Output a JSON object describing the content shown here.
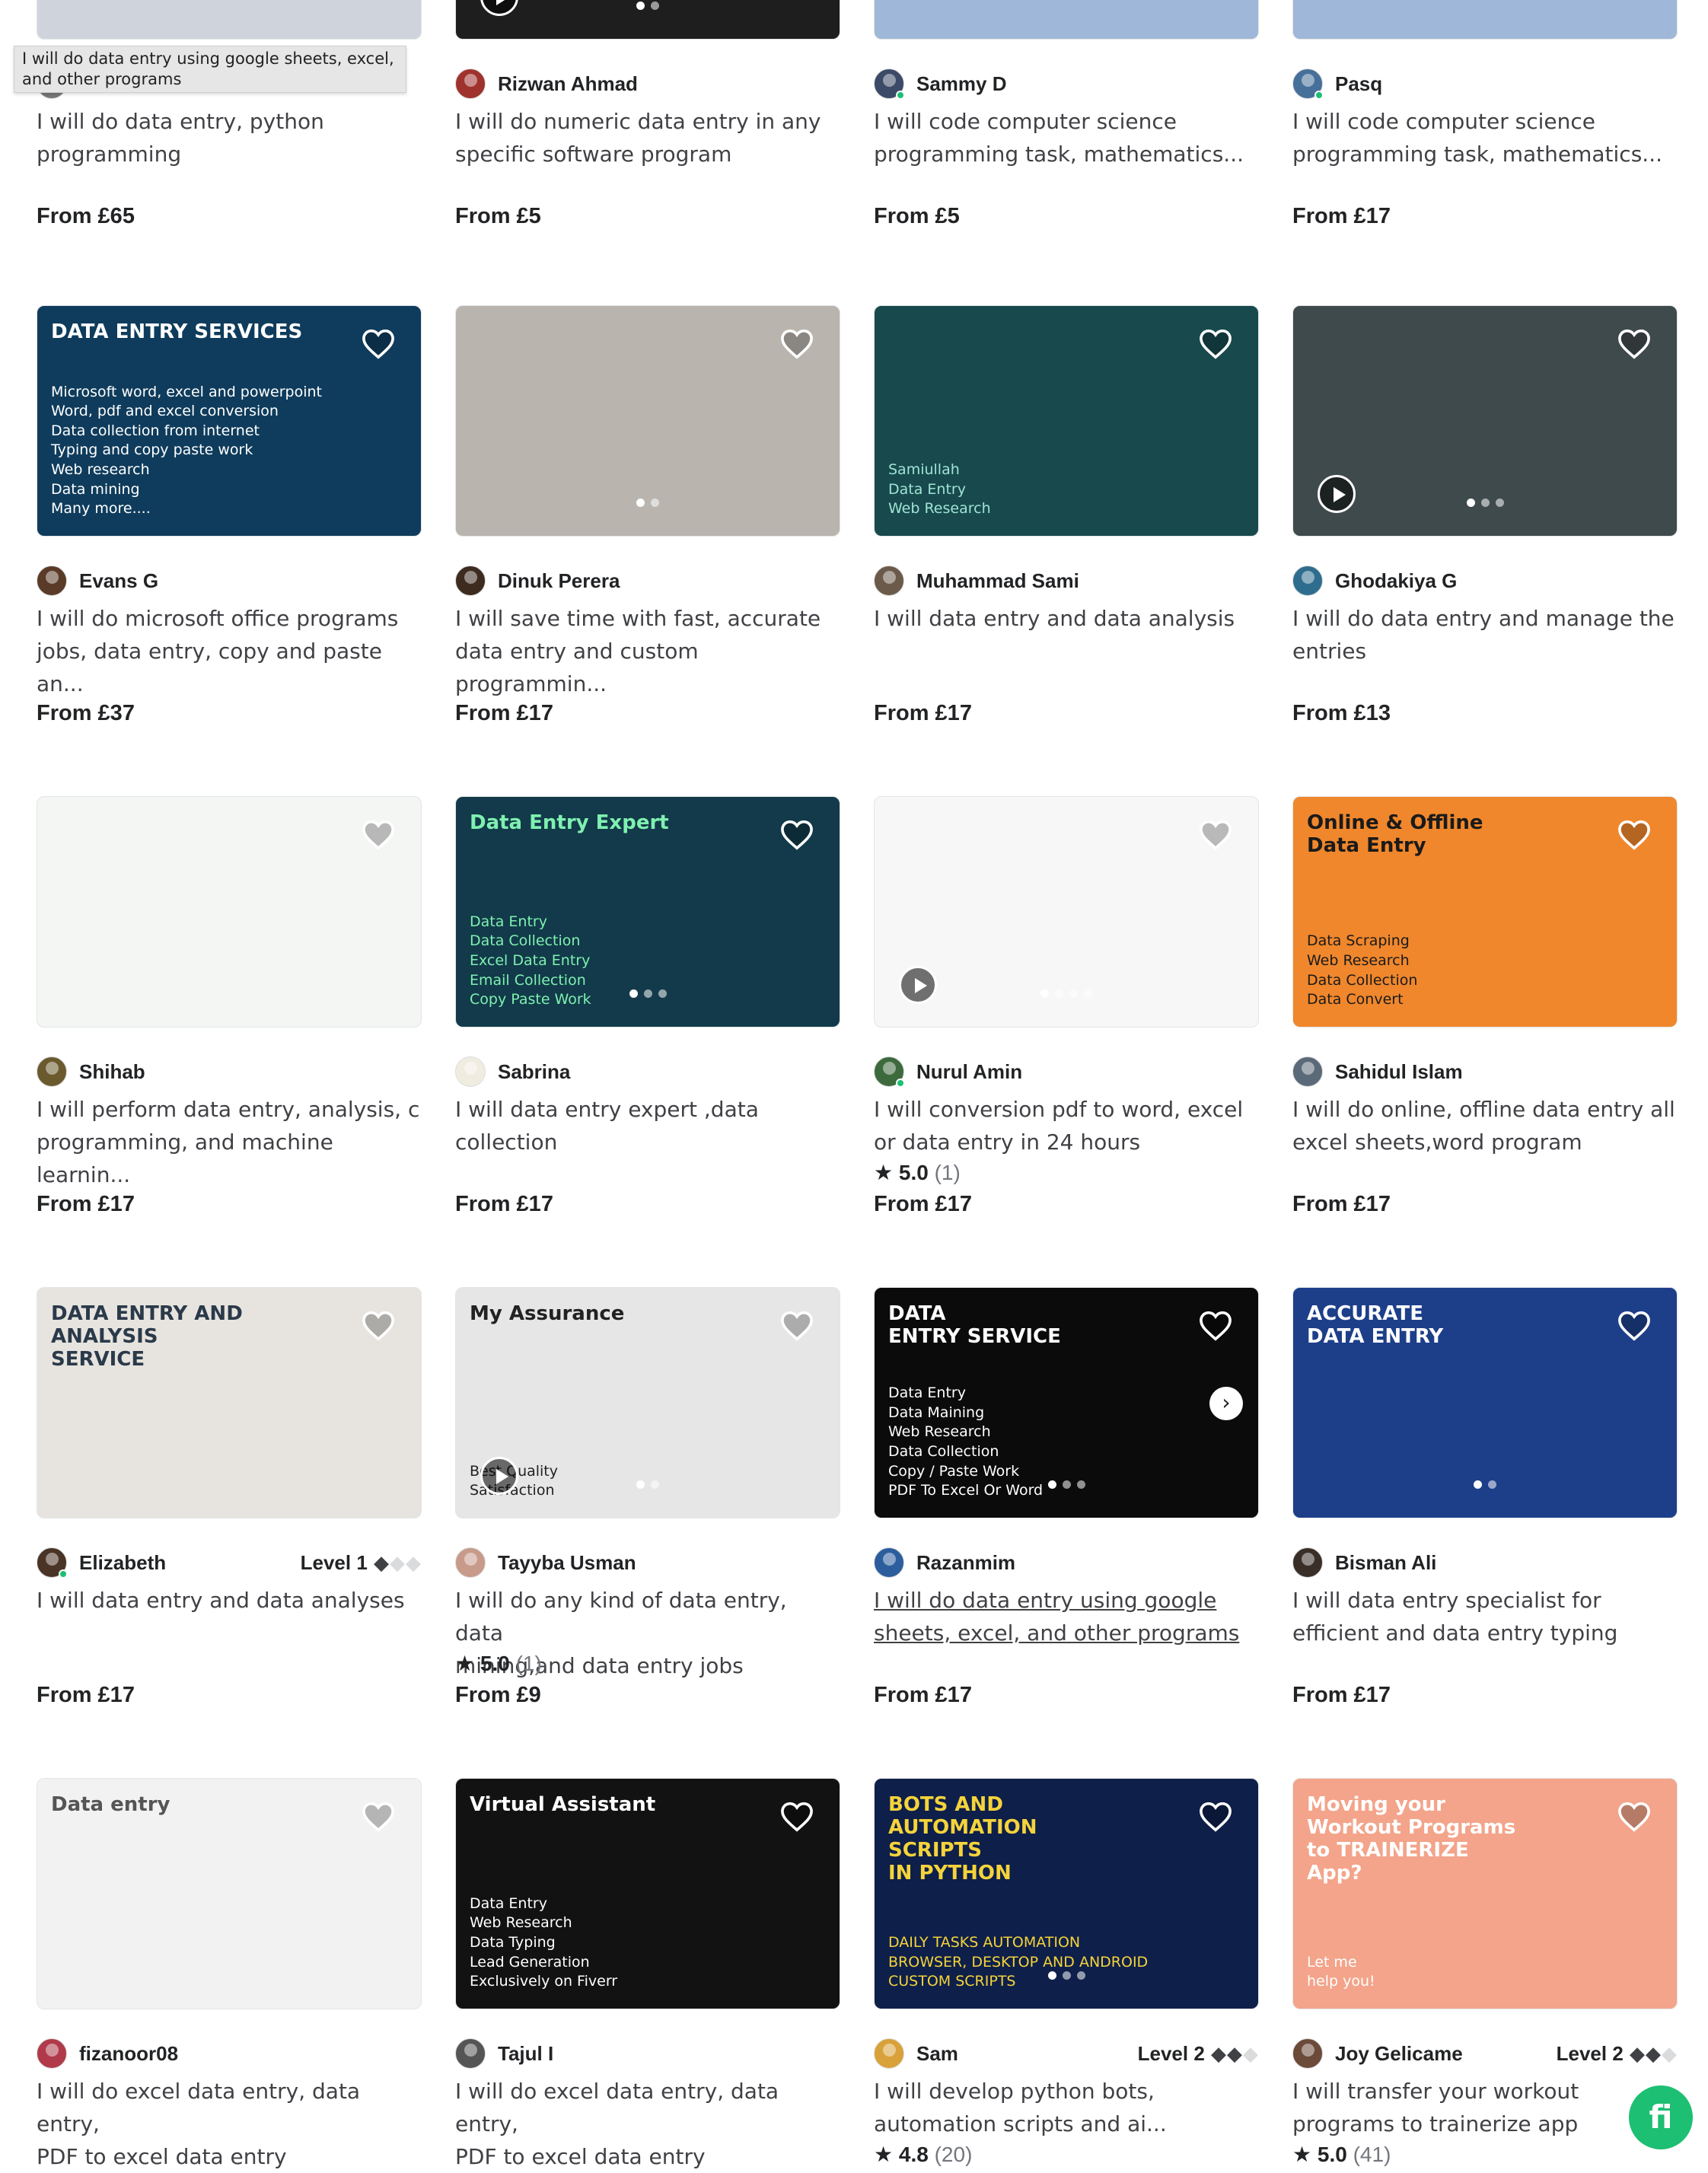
{
  "tooltip": "I will do data entry using google sheets, excel, and other programs",
  "chat_button_label": "fi",
  "cards": [
    {
      "seller": "",
      "level": "",
      "level_on": 0,
      "title": "I will do data entry, python\nprogramming",
      "price": "From £65",
      "rating": "",
      "rating_count": "",
      "thumb_bg": "#cfd4dc",
      "thumb_text": "",
      "thumb_sub": "",
      "thumb_color": "#222",
      "play": false,
      "dots": 0,
      "online": false,
      "avatar_color": "#777",
      "underline": false
    },
    {
      "seller": "Rizwan Ahmad",
      "level": "",
      "level_on": 0,
      "title": "I will do numeric data entry in any\nspecific software program",
      "price": "From £5",
      "rating": "",
      "rating_count": "",
      "thumb_bg": "#1e1e1e",
      "thumb_text": "",
      "thumb_sub": "",
      "thumb_color": "#fff",
      "play": true,
      "dots": 2,
      "online": false,
      "avatar_color": "#a0322e",
      "underline": false
    },
    {
      "seller": "Sammy D",
      "level": "",
      "level_on": 0,
      "title": "I will code computer science\nprogramming task, mathematics...",
      "price": "From £5",
      "rating": "",
      "rating_count": "",
      "thumb_bg": "#9fb7d8",
      "thumb_text": "",
      "thumb_sub": "",
      "thumb_color": "#222",
      "play": false,
      "dots": 0,
      "online": true,
      "avatar_color": "#3b4a66",
      "underline": false
    },
    {
      "seller": "Pasq",
      "level": "",
      "level_on": 0,
      "title": "I will code computer science\nprogramming task, mathematics...",
      "price": "From £17",
      "rating": "",
      "rating_count": "",
      "thumb_bg": "#9fb7d8",
      "thumb_text": "",
      "thumb_sub": "",
      "thumb_color": "#222",
      "play": false,
      "dots": 0,
      "online": true,
      "avatar_color": "#46709a",
      "underline": false
    },
    {
      "seller": "Evans G",
      "level": "",
      "level_on": 0,
      "title": "I will do microsoft office programs\njobs, data entry, copy and paste an...",
      "price": "From £37",
      "rating": "",
      "rating_count": "",
      "thumb_bg": "#0f3c5c",
      "thumb_text": "DATA ENTRY SERVICES",
      "thumb_sub": "Microsoft word, excel and powerpoint\nWord, pdf and excel conversion\nData collection from internet\nTyping and copy paste work\nWeb research\nData mining\nMany more....",
      "thumb_color": "#ffffff",
      "play": false,
      "dots": 0,
      "online": false,
      "avatar_color": "#5a3b28",
      "underline": false
    },
    {
      "seller": "Dinuk Perera",
      "level": "",
      "level_on": 0,
      "title": "I will save time with fast, accurate\ndata entry and custom programmin...",
      "price": "From £17",
      "rating": "",
      "rating_count": "",
      "thumb_bg": "#b9b5ae",
      "thumb_text": "",
      "thumb_sub": "",
      "thumb_color": "#222",
      "play": false,
      "dots": 2,
      "online": false,
      "avatar_color": "#3d2b20",
      "underline": false
    },
    {
      "seller": "Muhammad Sami",
      "level": "",
      "level_on": 0,
      "title": "I will data entry and data analysis",
      "price": "From £17",
      "rating": "",
      "rating_count": "",
      "thumb_bg": "#17494d",
      "thumb_text": "",
      "thumb_sub": "Samiullah\nData Entry\nWeb Research",
      "thumb_color": "#9fe3d4",
      "play": false,
      "dots": 0,
      "online": false,
      "avatar_color": "#6b5a4a",
      "underline": false
    },
    {
      "seller": "Ghodakiya G",
      "level": "",
      "level_on": 0,
      "title": "I will do data entry and manage the\nentries",
      "price": "From £13",
      "rating": "",
      "rating_count": "",
      "thumb_bg": "#3f4a4c",
      "thumb_text": "",
      "thumb_sub": "",
      "thumb_color": "#fff",
      "play": true,
      "dots": 3,
      "online": false,
      "avatar_color": "#2f6d8e",
      "underline": false
    },
    {
      "seller": "Shihab",
      "level": "",
      "level_on": 0,
      "title": "I will perform data entry, analysis, c\nprogramming, and machine learnin...",
      "price": "From £17",
      "rating": "",
      "rating_count": "",
      "thumb_bg": "#f4f6f4",
      "thumb_text": "",
      "thumb_sub": "",
      "thumb_color": "#222",
      "play": false,
      "dots": 0,
      "online": false,
      "avatar_color": "#6b5a2e",
      "underline": false
    },
    {
      "seller": "Sabrina",
      "level": "",
      "level_on": 0,
      "title": "I will data entry expert ,data\ncollection",
      "price": "From £17",
      "rating": "",
      "rating_count": "",
      "thumb_bg": "#123a4a",
      "thumb_text": "Data Entry Expert",
      "thumb_sub": "Data Entry\nData Collection\nExcel Data Entry\nEmail Collection\nCopy Paste Work",
      "thumb_color": "#7ff0b0",
      "play": false,
      "dots": 3,
      "online": false,
      "avatar_color": "#f1ece0",
      "underline": false
    },
    {
      "seller": "Nurul Amin",
      "level": "",
      "level_on": 0,
      "title": "I will conversion pdf to word, excel\nor data entry in 24 hours",
      "price": "From £17",
      "rating": "5.0",
      "rating_count": "(1)",
      "thumb_bg": "#f7f7f7",
      "thumb_text": "",
      "thumb_sub": "",
      "thumb_color": "#999",
      "play": true,
      "dots": 4,
      "online": true,
      "avatar_color": "#3d6a3d",
      "underline": false
    },
    {
      "seller": "Sahidul Islam",
      "level": "",
      "level_on": 0,
      "title": "I will do online, offline data entry all\nexcel sheets,word program",
      "price": "From £17",
      "rating": "",
      "rating_count": "",
      "thumb_bg": "#f0872c",
      "thumb_text": "Online & Offline\nData Entry",
      "thumb_sub": "Data Scraping\nWeb Research\nData Collection\nData Convert",
      "thumb_color": "#1a1a1a",
      "play": false,
      "dots": 0,
      "online": false,
      "avatar_color": "#5b6a78",
      "underline": false
    },
    {
      "seller": "Elizabeth",
      "level": "Level 1",
      "level_on": 1,
      "title": "I will data entry and data analyses",
      "price": "From £17",
      "rating": "",
      "rating_count": "",
      "thumb_bg": "#e7e4df",
      "thumb_text": "DATA ENTRY AND\nANALYSIS\nSERVICE",
      "thumb_sub": "",
      "thumb_color": "#2b3a4a",
      "play": false,
      "dots": 0,
      "online": true,
      "avatar_color": "#4a3426",
      "underline": false
    },
    {
      "seller": "Tayyba Usman",
      "level": "",
      "level_on": 0,
      "title": "I will do any kind of data entry, data\nmining,and data entry jobs",
      "price": "From £9",
      "rating": "5.0",
      "rating_count": "(1)",
      "thumb_bg": "#e6e6e6",
      "thumb_text": "My Assurance",
      "thumb_sub": "Best Quality\nSatisfaction",
      "thumb_color": "#222",
      "play": true,
      "dots": 2,
      "online": false,
      "avatar_color": "#c79a8a",
      "underline": false
    },
    {
      "seller": "Razanmim",
      "level": "",
      "level_on": 0,
      "title": "I will do data entry using google\nsheets, excel, and other programs",
      "price": "From £17",
      "rating": "",
      "rating_count": "",
      "thumb_bg": "#0b0b0b",
      "thumb_text": "DATA\nENTRY SERVICE",
      "thumb_sub": "Data Entry\nData Maining\nWeb Research\nData Collection\nCopy / Paste Work\nPDF To Excel Or Word",
      "thumb_color": "#ffffff",
      "play": false,
      "dots": 3,
      "online": false,
      "avatar_color": "#2c5e9e",
      "underline": true
    },
    {
      "seller": "Bisman Ali",
      "level": "",
      "level_on": 0,
      "title": "I will data entry specialist for\nefficient and data entry typing",
      "price": "From £17",
      "rating": "",
      "rating_count": "",
      "thumb_bg": "#1d3f8a",
      "thumb_text": "ACCURATE\nDATA ENTRY",
      "thumb_sub": "",
      "thumb_color": "#ffffff",
      "play": false,
      "dots": 2,
      "online": false,
      "avatar_color": "#3a2e28",
      "underline": false
    },
    {
      "seller": "fizanoor08",
      "level": "",
      "level_on": 0,
      "title": "I will do excel data entry, data entry,\nPDF to excel data entry",
      "price": "",
      "rating": "",
      "rating_count": "",
      "thumb_bg": "#f2f2f2",
      "thumb_text": "Data entry",
      "thumb_sub": "",
      "thumb_color": "#555",
      "play": false,
      "dots": 0,
      "online": false,
      "avatar_color": "#b03a4a",
      "underline": false
    },
    {
      "seller": "Tajul I",
      "level": "",
      "level_on": 0,
      "title": "I will do excel data entry, data entry,\nPDF to excel data entry",
      "price": "",
      "rating": "",
      "rating_count": "",
      "thumb_bg": "#121212",
      "thumb_text": "Virtual Assistant",
      "thumb_sub": "Data Entry\nWeb Research\nData Typing\nLead Generation\nExclusively on Fiverr",
      "thumb_color": "#ffffff",
      "play": false,
      "dots": 0,
      "online": false,
      "avatar_color": "#555",
      "underline": false
    },
    {
      "seller": "Sam",
      "level": "Level 2",
      "level_on": 2,
      "title": "I will develop python bots,\nautomation scripts and ai...",
      "price": "",
      "rating": "4.8",
      "rating_count": "(20)",
      "thumb_bg": "#0e1f4a",
      "thumb_text": "BOTS AND\nAUTOMATION\nSCRIPTS\nIN PYTHON",
      "thumb_sub": "DAILY TASKS AUTOMATION\nBROWSER, DESKTOP AND ANDROID\nCUSTOM SCRIPTS",
      "thumb_color": "#f5d33a",
      "play": false,
      "dots": 3,
      "online": false,
      "avatar_color": "#d9a13a",
      "underline": false
    },
    {
      "seller": "Joy Gelicame",
      "level": "Level 2",
      "level_on": 2,
      "title": "I will transfer your workout\nprograms to trainerize app",
      "price": "",
      "rating": "5.0",
      "rating_count": "(41)",
      "thumb_bg": "#f3a48a",
      "thumb_text": "Moving your\nWorkout Programs\nto TRAINERIZE\nApp?",
      "thumb_sub": "Let me\nhelp you!",
      "thumb_color": "#ffffff",
      "play": false,
      "dots": 0,
      "online": false,
      "avatar_color": "#6b4a3a",
      "underline": false
    }
  ]
}
